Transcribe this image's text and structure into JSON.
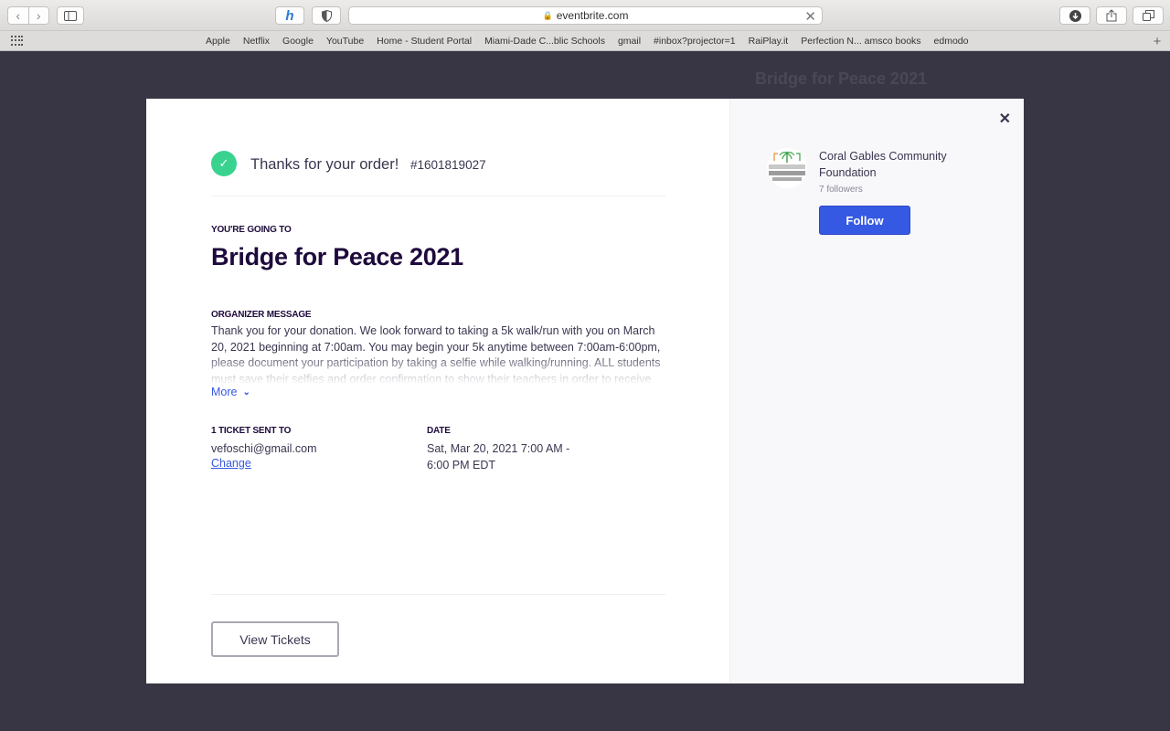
{
  "browser": {
    "url": "eventbrite.com",
    "bookmarks": [
      "Apple",
      "Netflix",
      "Google",
      "YouTube",
      "Home - Student Portal",
      "Miami-Dade C...blic Schools",
      "gmail",
      "#inbox?projector=1",
      "RaiPlay.it",
      "Perfection N... amsco books",
      "edmodo"
    ],
    "honey_glyph": "h"
  },
  "backdrop": {
    "event_title": "Bridge for Peace 2021"
  },
  "order": {
    "thanks": "Thanks for your order!",
    "order_number": "#1601819027",
    "going_label": "YOU'RE GOING TO",
    "event_title": "Bridge for Peace 2021",
    "organizer_message_label": "ORGANIZER MESSAGE",
    "organizer_message": "Thank you for your donation. We look forward to taking a 5k walk/run with you on March 20, 2021 beginning at 7:00am. You may begin your 5k anytime between 7:00am-6:00pm, please document your participation by taking a selfie while walking/running. ALL students must save their selfies and order confirmation to show their teachers in order to receive",
    "more_label": "More",
    "tickets_label": "1 TICKET SENT TO",
    "email": "vefoschi@gmail.com",
    "change_label": "Change",
    "date_label": "DATE",
    "date_line1": "Sat, Mar 20, 2021 7:00 AM -",
    "date_line2": "6:00 PM EDT",
    "view_tickets_label": "View Tickets"
  },
  "organizer": {
    "name": "Coral Gables Community Foundation",
    "followers": "7 followers",
    "follow_label": "Follow",
    "logo_colors": {
      "palm": "#3aa04a",
      "text": "#5a5a5a",
      "orange": "#e8892b"
    }
  },
  "colors": {
    "accent_blue": "#3659e3",
    "success_green": "#3ad28f",
    "title_dark": "#1e0a3c"
  }
}
